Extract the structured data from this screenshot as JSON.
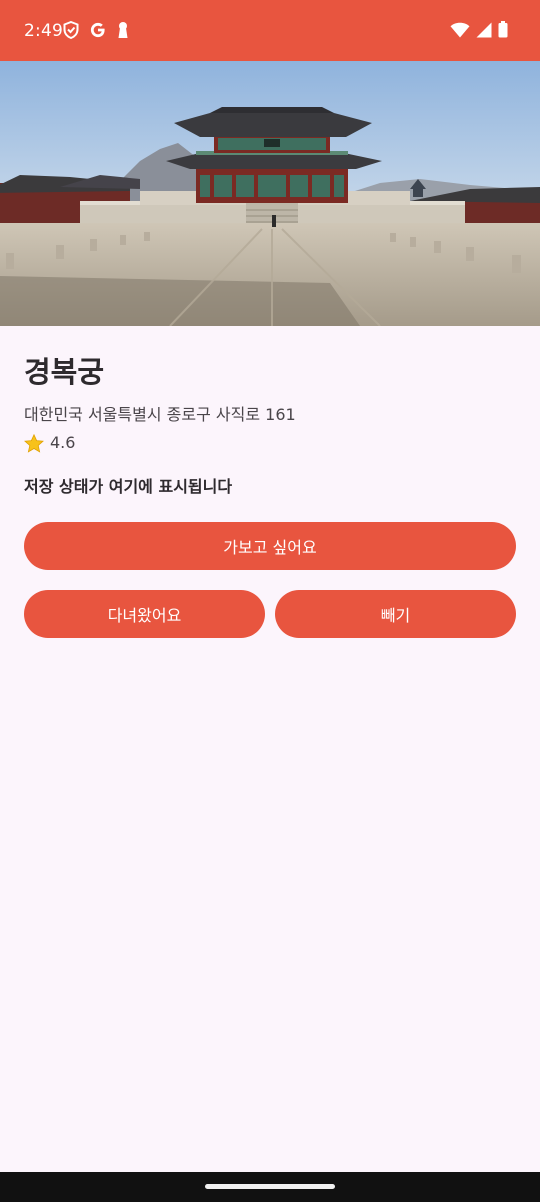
{
  "status_bar": {
    "time": "2:49",
    "background": "#e8553f",
    "left_icons": [
      "shield-icon",
      "google-icon",
      "keyhole-icon"
    ],
    "right_icons": [
      "wifi-icon",
      "signal-icon",
      "battery-icon"
    ]
  },
  "hero_image": {
    "subject": "palace-photo"
  },
  "place": {
    "name": "경복궁",
    "address": "대한민국 서울특별시 종로구 사직로 161",
    "rating_icon": "star-icon",
    "rating": "4.6"
  },
  "save_status": "저장 상태가 여기에 표시됩니다",
  "actions": {
    "want_to_go": "가보고 싶어요",
    "visited": "다녀왔어요",
    "remove": "빼기"
  },
  "colors": {
    "accent": "#e8553f",
    "background": "#fcf5fc",
    "text_primary": "#2e2a2e",
    "text_secondary": "#4a454a"
  }
}
